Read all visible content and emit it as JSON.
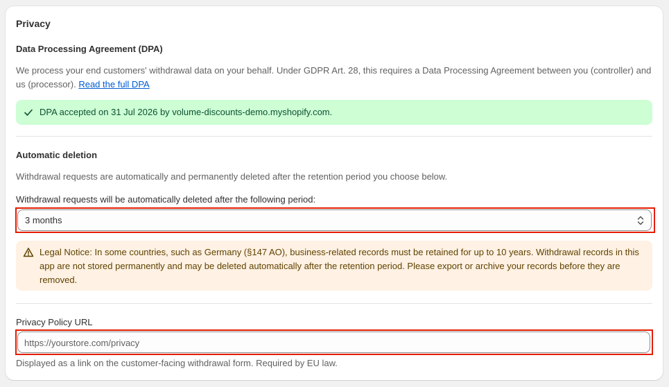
{
  "section": {
    "title": "Privacy"
  },
  "dpa": {
    "heading": "Data Processing Agreement (DPA)",
    "description": "We process your end customers' withdrawal data on your behalf. Under GDPR Art. 28, this requires a Data Processing Agreement between you (controller) and us (processor).",
    "link_label": "Read the full DPA",
    "accepted_message": "DPA accepted on 31 Jul 2026 by volume-discounts-demo.myshopify.com.",
    "accepted_color": "#cdfed4"
  },
  "deletion": {
    "heading": "Automatic deletion",
    "description": "Withdrawal requests are automatically and permanently deleted after the retention period you choose below.",
    "select_label": "Withdrawal requests will be automatically deleted after the following period:",
    "selected_value": "3 months",
    "legal_notice": "Legal Notice: In some countries, such as Germany (§147 AO), business-related records must be retained for up to 10 years. Withdrawal records in this app are not stored permanently and may be deleted automatically after the retention period. Please export or archive your records before they are removed.",
    "notice_color": "#fff1e3"
  },
  "privacy_policy": {
    "label": "Privacy Policy URL",
    "placeholder": "https://yourstore.com/privacy",
    "value": "",
    "help_text": "Displayed as a link on the customer-facing withdrawal form. Required by EU law."
  },
  "icons": {
    "success": "checkmark-icon",
    "warning": "alert-triangle-icon",
    "select": "select-chevron-icon"
  },
  "colors": {
    "highlight_outline": "#e51c00",
    "link": "#005bd3"
  }
}
